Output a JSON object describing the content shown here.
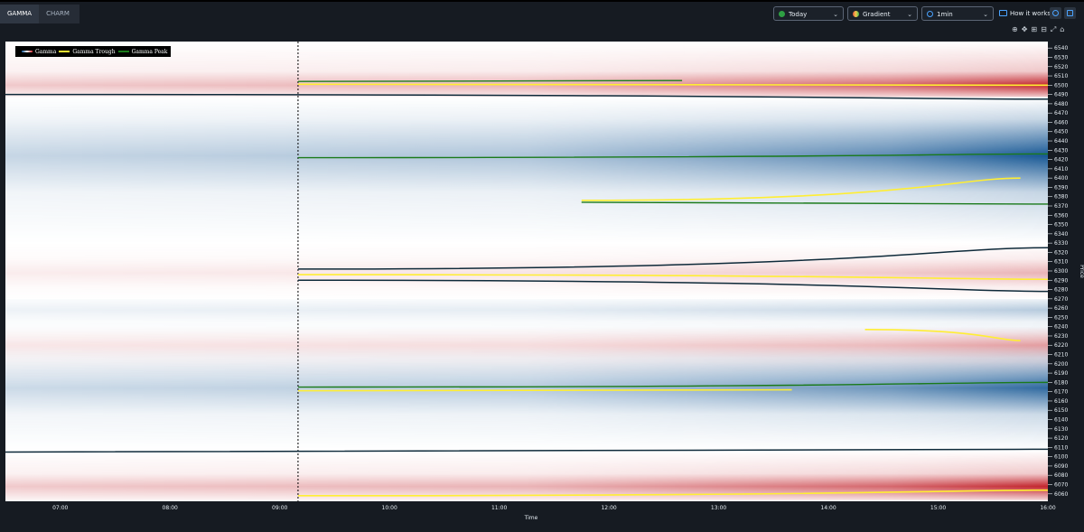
{
  "tabs": [
    {
      "label": "GAMMA",
      "active": true
    },
    {
      "label": "CHARM",
      "active": false
    }
  ],
  "controls": {
    "date": "Today",
    "style": "Gradient",
    "interval": "1min",
    "how_label": "How it works?"
  },
  "colors": {
    "positive": "#c2242c",
    "negative": "#0b4f8f",
    "trough": "#ffee33",
    "peak": "#1a7a1a",
    "zero": "#0e2a3a"
  },
  "chart_data": {
    "type": "heatmap",
    "xlabel": "Time",
    "ylabel": "Price",
    "xlim": [
      "06:30",
      "16:00"
    ],
    "ylim": [
      6052,
      6547
    ],
    "x_ticks": [
      "07:00",
      "08:00",
      "09:00",
      "10:00",
      "11:00",
      "12:00",
      "13:00",
      "14:00",
      "15:00",
      "16:00"
    ],
    "y_ticks": [
      6540,
      6530,
      6520,
      6510,
      6500,
      6490,
      6480,
      6470,
      6460,
      6450,
      6440,
      6430,
      6420,
      6410,
      6400,
      6390,
      6380,
      6370,
      6360,
      6350,
      6340,
      6330,
      6320,
      6310,
      6300,
      6290,
      6280,
      6270,
      6260,
      6250,
      6240,
      6230,
      6220,
      6210,
      6200,
      6190,
      6180,
      6170,
      6160,
      6150,
      6140,
      6130,
      6120,
      6110,
      6100,
      6090,
      6080,
      6070,
      6060
    ],
    "market_open_marker": "09:10",
    "legend": [
      "Gamma",
      "Gamma Trough",
      "Gamma Peak"
    ],
    "bands": [
      {
        "from": 6487,
        "to": 6547,
        "sign": "positive",
        "peak_price": 6500,
        "peak_value": 1.0
      },
      {
        "from": 6330,
        "to": 6487,
        "sign": "negative",
        "peak_price": 6424,
        "peak_value": -0.95
      },
      {
        "from": 6270,
        "to": 6330,
        "sign": "positive",
        "peak_price": 6298,
        "peak_value": 0.35
      },
      {
        "from": 6220,
        "to": 6270,
        "sign": "negative",
        "peak_price": 6258,
        "peak_value": -0.3
      },
      {
        "from": 6185,
        "to": 6240,
        "sign": "positive",
        "peak_price": 6220,
        "peak_value": 0.45
      },
      {
        "from": 6107,
        "to": 6220,
        "sign": "negative",
        "peak_price": 6174,
        "peak_value": -0.85
      },
      {
        "from": 6052,
        "to": 6107,
        "sign": "positive",
        "peak_price": 6068,
        "peak_value": 1.0
      }
    ],
    "gamma_trough": [
      {
        "start": "09:10",
        "price": 6501,
        "end_price": 6500,
        "end": "16:00"
      },
      {
        "start": "09:10",
        "price": 6296,
        "end_price": 6291,
        "end": "16:00"
      },
      {
        "start": "09:10",
        "price": 6171,
        "end_price": 6172,
        "end": "13:40"
      },
      {
        "start": "09:10",
        "price": 6058,
        "end_price": 6064,
        "end": "16:00"
      },
      {
        "start": "11:45",
        "price": 6376,
        "end_price": 6400,
        "end": "15:45"
      },
      {
        "start": "14:20",
        "price": 6237,
        "end_price": 6225,
        "end": "15:45"
      }
    ],
    "gamma_peak": [
      {
        "start": "09:10",
        "price": 6422,
        "end_price": 6426,
        "end": "16:00"
      },
      {
        "start": "09:10",
        "price": 6175,
        "end_price": 6180,
        "end": "16:00"
      },
      {
        "start": "09:10",
        "price": 6504,
        "end_price": 6505,
        "end": "12:40"
      },
      {
        "start": "11:45",
        "price": 6374,
        "end_price": 6372,
        "end": "16:00"
      }
    ],
    "zero_gamma": [
      {
        "start": "06:30",
        "price": 6490,
        "end_price": 6485,
        "end": "16:00"
      },
      {
        "start": "06:30",
        "price": 6105,
        "end_price": 6108,
        "end": "16:00"
      },
      {
        "start": "09:10",
        "price": 6302,
        "end_price": 6325,
        "end": "16:00"
      },
      {
        "start": "09:10",
        "price": 6290,
        "end_price": 6278,
        "end": "16:00"
      }
    ]
  }
}
